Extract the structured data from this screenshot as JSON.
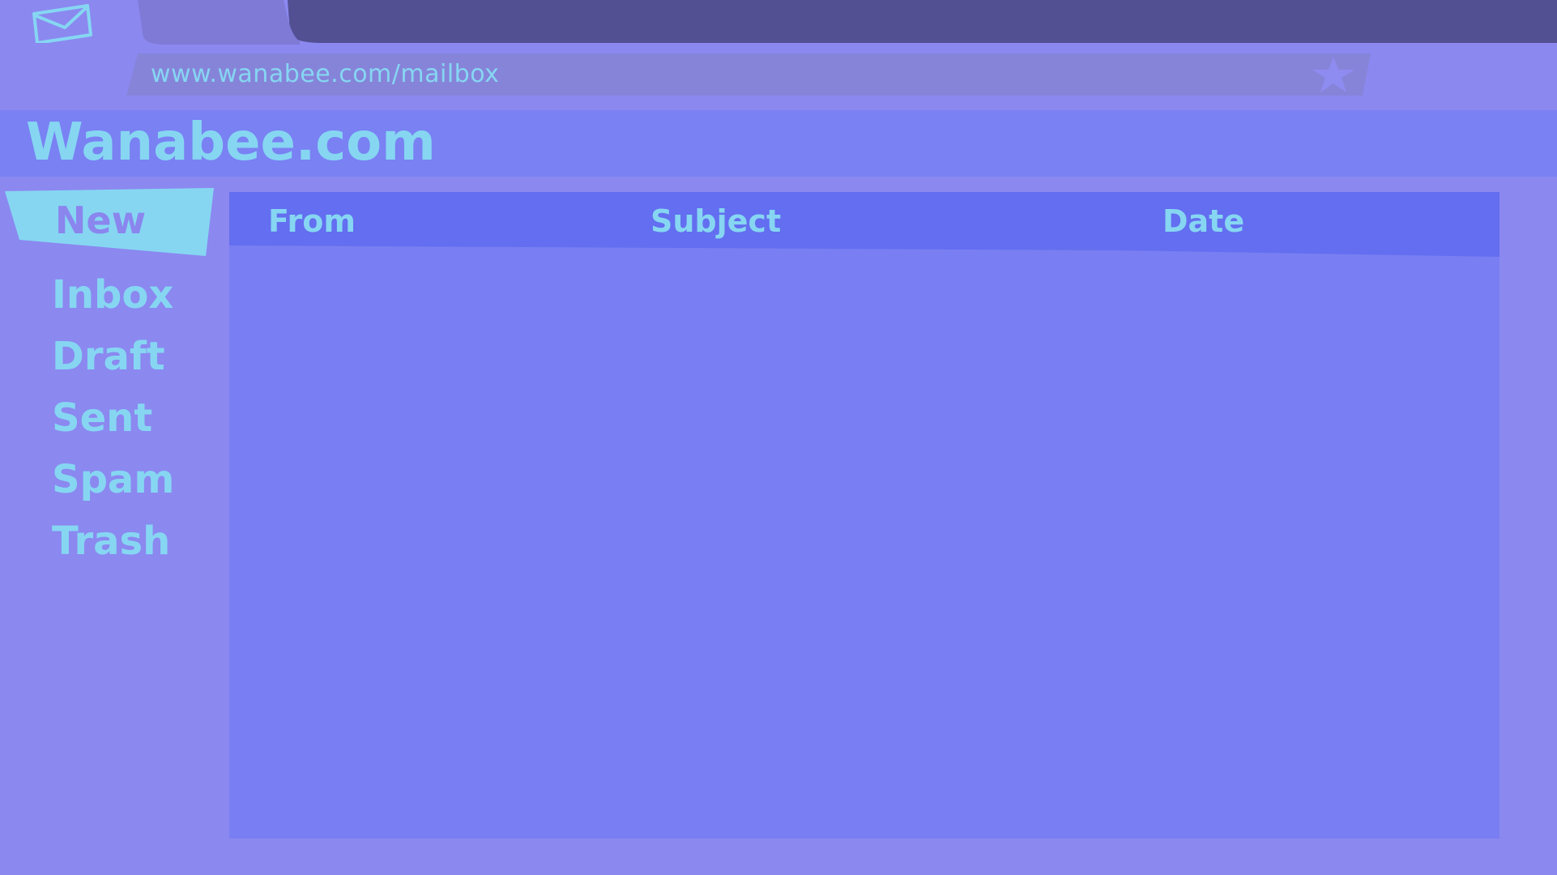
{
  "browser": {
    "url": "www.wanabee.com/mailbox",
    "tab_icon": "envelope-icon",
    "bookmark_icon": "star-icon"
  },
  "site": {
    "title": "Wanabee.com"
  },
  "sidebar": {
    "new_button": "New",
    "folders": [
      {
        "label": "Inbox"
      },
      {
        "label": "Draft"
      },
      {
        "label": "Sent"
      },
      {
        "label": "Spam"
      },
      {
        "label": "Trash"
      }
    ]
  },
  "mail_table": {
    "columns": {
      "from": "From",
      "subject": "Subject",
      "date": "Date"
    },
    "rows": []
  },
  "colors": {
    "page_background": "#8b88f0",
    "tab_bar": "#524f93",
    "inactive_tab": "#7f7ad6",
    "url_bar": "#8684d9",
    "header_band": "#7981f3",
    "table_header": "#636ef0",
    "table_body": "#797ff2",
    "text_accent": "#86d6f2",
    "new_button_fill": "#86d6f2"
  }
}
